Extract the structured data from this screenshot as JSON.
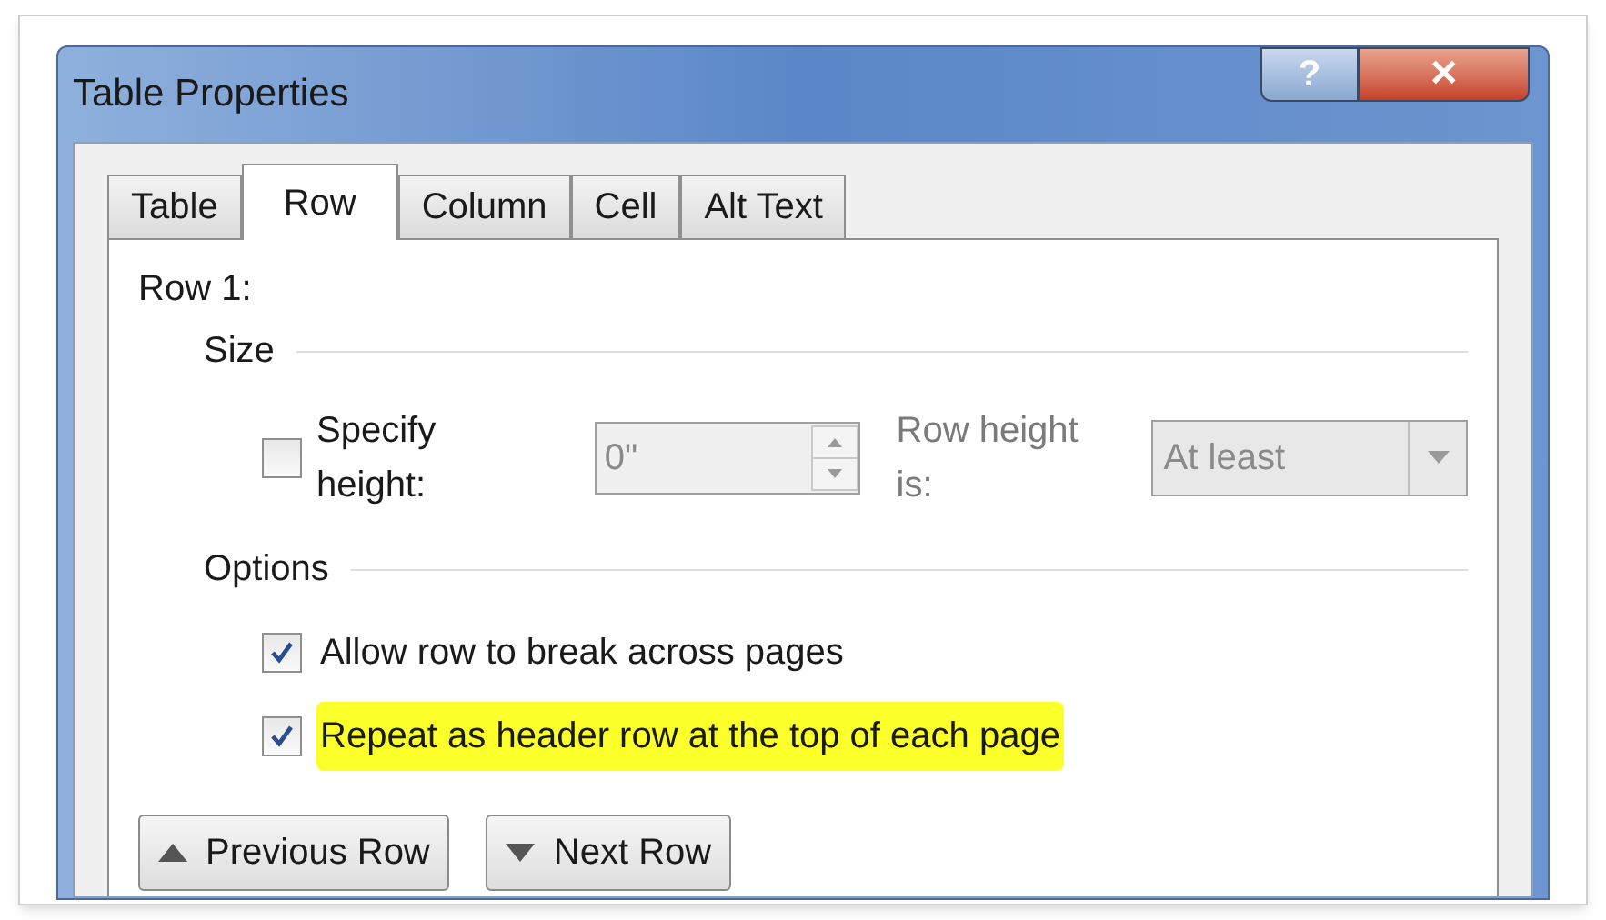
{
  "window": {
    "title": "Table Properties",
    "help_button": "?",
    "close_button": "✕"
  },
  "tabs": [
    {
      "label": "Table",
      "selected": false
    },
    {
      "label": "Row",
      "selected": true
    },
    {
      "label": "Column",
      "selected": false
    },
    {
      "label": "Cell",
      "selected": false
    },
    {
      "label": "Alt Text",
      "selected": false
    }
  ],
  "row_label": "Row 1:",
  "size": {
    "heading": "Size",
    "specify_height": {
      "label": "Specify height:",
      "checked": false
    },
    "height_field": {
      "value": "0\"",
      "disabled": true
    },
    "row_height_label": "Row height is:",
    "row_height_select": {
      "value": "At least",
      "disabled": true
    }
  },
  "options": {
    "heading": "Options",
    "items": [
      {
        "label": "Allow row to break across pages",
        "checked": true,
        "highlighted": false
      },
      {
        "label": "Repeat as header row at the top of each page",
        "checked": true,
        "highlighted": true
      }
    ]
  },
  "buttons": [
    {
      "label": "Previous Row",
      "kind": "up"
    },
    {
      "label": "Next Row",
      "kind": "down"
    }
  ]
}
